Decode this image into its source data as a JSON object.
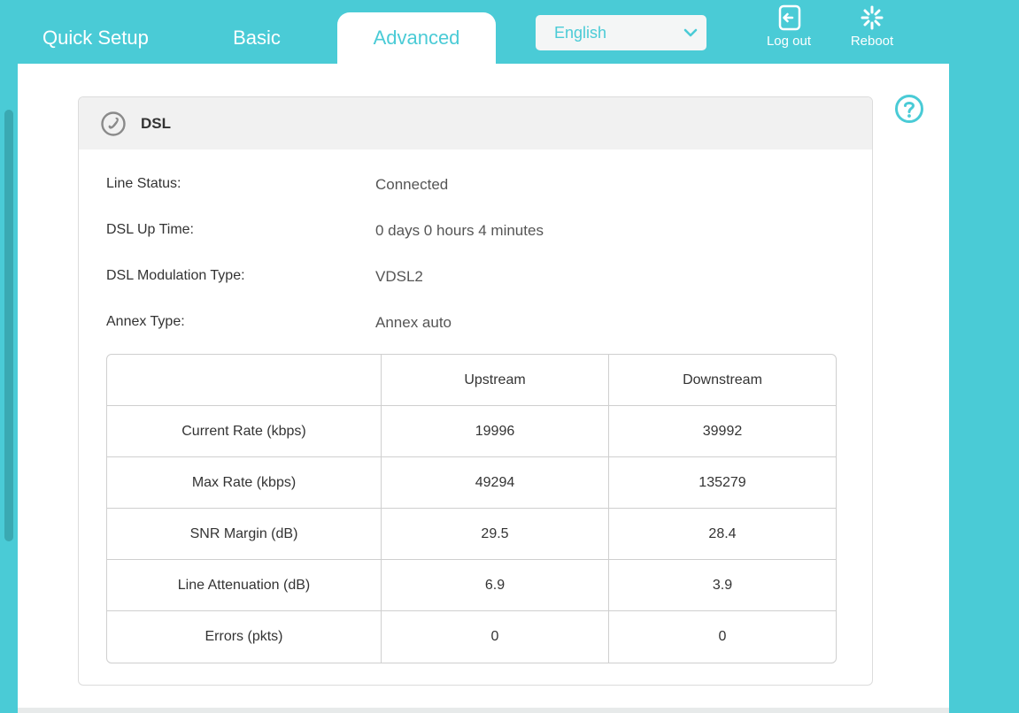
{
  "nav": {
    "tabs": [
      {
        "label": "Quick Setup"
      },
      {
        "label": "Basic"
      },
      {
        "label": "Advanced",
        "active": true
      }
    ],
    "language": "English",
    "logout_label": "Log out",
    "reboot_label": "Reboot"
  },
  "colors": {
    "brand": "#4acbd6",
    "panel": "#ffffff",
    "header_bg": "#f1f1f1"
  },
  "icons": {
    "logout": "logout-icon",
    "reboot": "reboot-icon",
    "help": "help-icon",
    "dsl": "phone-icon",
    "language_dropdown": "chevron-down-icon"
  },
  "dsl": {
    "title": "DSL",
    "info": [
      {
        "label": "Line Status:",
        "value": "Connected"
      },
      {
        "label": "DSL Up Time:",
        "value": "0 days 0 hours 4 minutes"
      },
      {
        "label": "DSL Modulation Type:",
        "value": "VDSL2"
      },
      {
        "label": "Annex Type:",
        "value": "Annex auto"
      }
    ],
    "table": {
      "headers": [
        "",
        "Upstream",
        "Downstream"
      ],
      "rows": [
        {
          "label": "Current Rate (kbps)",
          "upstream": "19996",
          "downstream": "39992"
        },
        {
          "label": "Max Rate (kbps)",
          "upstream": "49294",
          "downstream": "135279"
        },
        {
          "label": "SNR Margin (dB)",
          "upstream": "29.5",
          "downstream": "28.4"
        },
        {
          "label": "Line Attenuation (dB)",
          "upstream": "6.9",
          "downstream": "3.9"
        },
        {
          "label": "Errors (pkts)",
          "upstream": "0",
          "downstream": "0"
        }
      ]
    }
  }
}
